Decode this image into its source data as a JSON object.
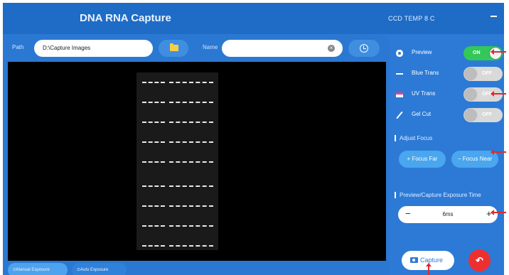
{
  "app": {
    "title": "DNA RNA Capture",
    "temperature": "CCD TEMP 8 C",
    "minimize_label": ""
  },
  "path_bar": {
    "path_label": "Path",
    "path_value": "D:\\Capture Images",
    "name_label": "Name",
    "name_value": "",
    "clear_glyph": "×",
    "folder_icon": "folder-icon",
    "history_icon": "history-icon"
  },
  "viewer": {
    "gel_rows": 9
  },
  "exposure_modes": {
    "manual": "⊙Manual Exposure",
    "auto": "⊙Auto Exposure"
  },
  "controls": {
    "preview": {
      "label": "Preview",
      "state": "ON",
      "icon": "eye-icon"
    },
    "blue_trans": {
      "label": "Blue Trans",
      "state": "OFF",
      "icon": "dash-icon"
    },
    "uv_trans": {
      "label": "UV Trans",
      "state": "OFF",
      "icon": "uv-icon"
    },
    "gel_cut": {
      "label": "Gel Cut",
      "state": "OFF",
      "icon": "knife-icon"
    }
  },
  "focus": {
    "title": "Adjust Focus",
    "far": "+ Focus Far",
    "near": "− Focus Near"
  },
  "exposure_time": {
    "title": "Preview/Capture Exposure Time",
    "minus": "−",
    "value": "6ms",
    "plus": "+"
  },
  "actions": {
    "capture": "Capture",
    "back_glyph": "↶"
  },
  "colors": {
    "accent": "#2a78d2",
    "toggle_on": "#34c759",
    "back_button": "#ee2f2f",
    "annotation": "#e02a2a"
  }
}
